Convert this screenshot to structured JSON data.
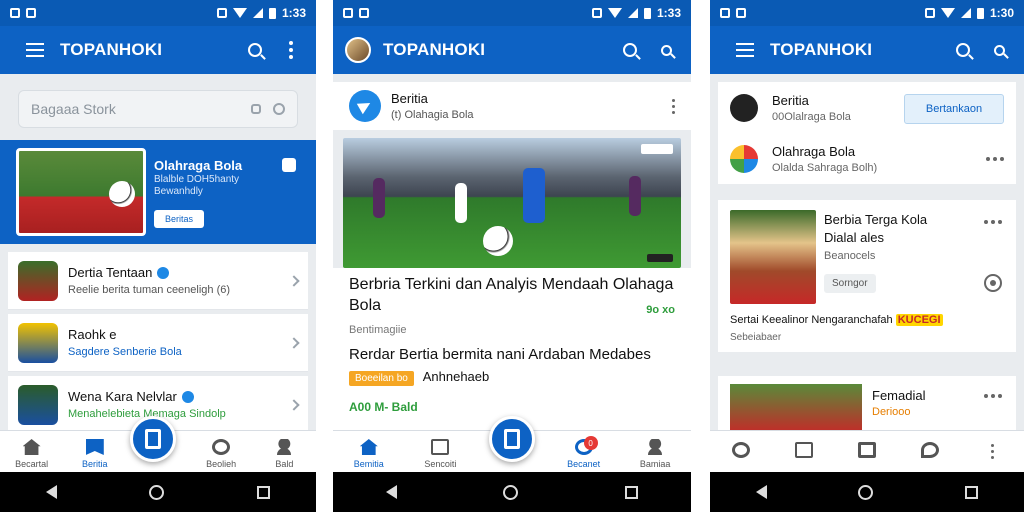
{
  "phones": [
    {
      "status": {
        "left1": "G",
        "left2": "G",
        "time": "1:33"
      },
      "appbar": {
        "title": "TOPANHOKI"
      },
      "search": {
        "placeholder": "Bagaaa Stork"
      },
      "hero": {
        "title": "Olahraga Bola",
        "subtitle": "Blalble DOH5hanty Bewanhdly",
        "button": "Beritas"
      },
      "list": [
        {
          "title": "Dertia Tentaan",
          "subtitle": "Reelie berita tuman ceeneligh (6)"
        },
        {
          "title": "Raohk e",
          "subtitle": "Sagdere Senberie Bola"
        },
        {
          "title": "Wena Kara Nelvlar",
          "subtitle": "Menahelebieta Memaga Sindolp"
        }
      ],
      "bottomnav": [
        "Becartal",
        "Beritia",
        "",
        "Beolieh",
        "Bald"
      ]
    },
    {
      "status": {
        "left1": "G",
        "left2": "G",
        "time": "1:33"
      },
      "appbar": {
        "title": "TOPANHOKI"
      },
      "head": {
        "title": "Beritia",
        "subtitle": "(t) Olahagia Bola"
      },
      "article": {
        "title": "Berbria Terkini dan Analyis Mendaah Olahaga Bola",
        "meta": "Bentimagiie",
        "green_tag": "9o xo",
        "subtitle": "Rerdar Bertia bermita nani Ardaban Medabes",
        "tag": "Boeeilan bo",
        "tag_text": "Anhnehaeb",
        "price": "A00 M- Bald"
      },
      "bottomnav": [
        "Bemitia",
        "Sencoiti",
        "",
        "Becanet",
        "Bamiaa"
      ],
      "badge": "0"
    },
    {
      "status": {
        "left1": "G",
        "left2": "G",
        "time": "1:30"
      },
      "appbar": {
        "title": "TOPANHOKI"
      },
      "rows": [
        {
          "title": "Beritia",
          "subtitle": "00Olalraga Bola",
          "button": "Bertankaon"
        },
        {
          "title": "Olahraga Bola",
          "subtitle": "Olalda Sahraga Bolh)"
        }
      ],
      "feature": {
        "title": "Berbia Terga Kola",
        "title2": "Dialal ales",
        "subtitle": "Beanocels",
        "button": "Sorngor",
        "desc": "Sertai Keealinor Nengaranchafah",
        "highlight": "KUCEGI",
        "desc2": "Sebeiabaer"
      },
      "bottom_card": {
        "title": "Femadial",
        "subtitle": "Deriooo"
      }
    }
  ]
}
